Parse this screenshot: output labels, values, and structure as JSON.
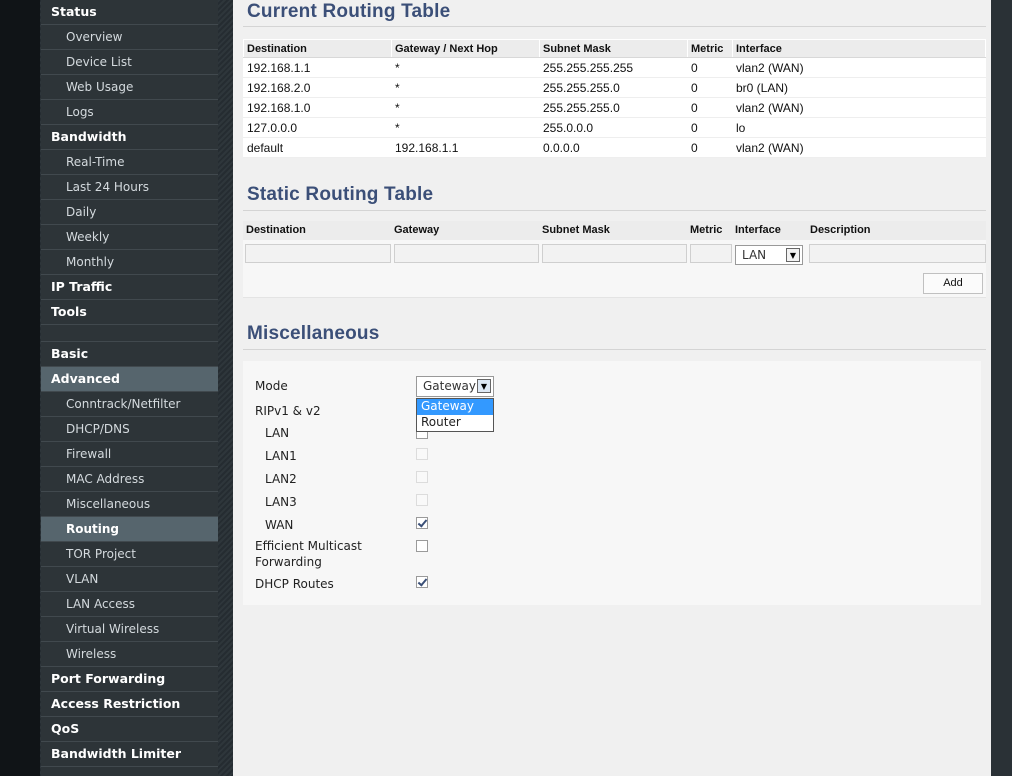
{
  "sidebar": {
    "items": [
      {
        "label": "Status",
        "type": "section"
      },
      {
        "label": "Overview",
        "type": "sub"
      },
      {
        "label": "Device List",
        "type": "sub"
      },
      {
        "label": "Web Usage",
        "type": "sub"
      },
      {
        "label": "Logs",
        "type": "sub"
      },
      {
        "label": "Bandwidth",
        "type": "section"
      },
      {
        "label": "Real-Time",
        "type": "sub"
      },
      {
        "label": "Last 24 Hours",
        "type": "sub"
      },
      {
        "label": "Daily",
        "type": "sub"
      },
      {
        "label": "Weekly",
        "type": "sub"
      },
      {
        "label": "Monthly",
        "type": "sub"
      },
      {
        "label": "IP Traffic",
        "type": "section"
      },
      {
        "label": "Tools",
        "type": "section"
      },
      {
        "label": "",
        "type": "gap"
      },
      {
        "label": "Basic",
        "type": "section"
      },
      {
        "label": "Advanced",
        "type": "section",
        "active": true
      },
      {
        "label": "Conntrack/Netfilter",
        "type": "sub"
      },
      {
        "label": "DHCP/DNS",
        "type": "sub"
      },
      {
        "label": "Firewall",
        "type": "sub"
      },
      {
        "label": "MAC Address",
        "type": "sub"
      },
      {
        "label": "Miscellaneous",
        "type": "sub"
      },
      {
        "label": "Routing",
        "type": "sub",
        "active": true
      },
      {
        "label": "TOR Project",
        "type": "sub"
      },
      {
        "label": "VLAN",
        "type": "sub"
      },
      {
        "label": "LAN Access",
        "type": "sub"
      },
      {
        "label": "Virtual Wireless",
        "type": "sub"
      },
      {
        "label": "Wireless",
        "type": "sub"
      },
      {
        "label": "Port Forwarding",
        "type": "section"
      },
      {
        "label": "Access Restriction",
        "type": "section"
      },
      {
        "label": "QoS",
        "type": "section"
      },
      {
        "label": "Bandwidth Limiter",
        "type": "section"
      }
    ]
  },
  "current_routing": {
    "title": "Current Routing Table",
    "columns": [
      "Destination",
      "Gateway / Next Hop",
      "Subnet Mask",
      "Metric",
      "Interface"
    ],
    "rows": [
      [
        "192.168.1.1",
        "*",
        "255.255.255.255",
        "0",
        "vlan2 (WAN)"
      ],
      [
        "192.168.2.0",
        "*",
        "255.255.255.0",
        "0",
        "br0 (LAN)"
      ],
      [
        "192.168.1.0",
        "*",
        "255.255.255.0",
        "0",
        "vlan2 (WAN)"
      ],
      [
        "127.0.0.0",
        "*",
        "255.0.0.0",
        "0",
        "lo"
      ],
      [
        "default",
        "192.168.1.1",
        "0.0.0.0",
        "0",
        "vlan2 (WAN)"
      ]
    ]
  },
  "static_routing": {
    "title": "Static Routing Table",
    "columns": [
      "Destination",
      "Gateway",
      "Subnet Mask",
      "Metric",
      "Interface",
      "Description"
    ],
    "interface_value": "LAN",
    "add_label": "Add"
  },
  "misc": {
    "title": "Miscellaneous",
    "mode_label": "Mode",
    "mode_value": "Gateway",
    "mode_options": [
      "Gateway",
      "Router"
    ],
    "rip_label": "RIPv1 & v2",
    "rip_lan": "LAN",
    "rip_lan1": "LAN1",
    "rip_lan2": "LAN2",
    "rip_lan3": "LAN3",
    "rip_wan": "WAN",
    "emf_label_line1": "Efficient Multicast",
    "emf_label_line2": "Forwarding",
    "dhcp_routes_label": "DHCP Routes",
    "rip_wan_checked": true,
    "emf_checked": false,
    "dhcp_routes_checked": true
  }
}
